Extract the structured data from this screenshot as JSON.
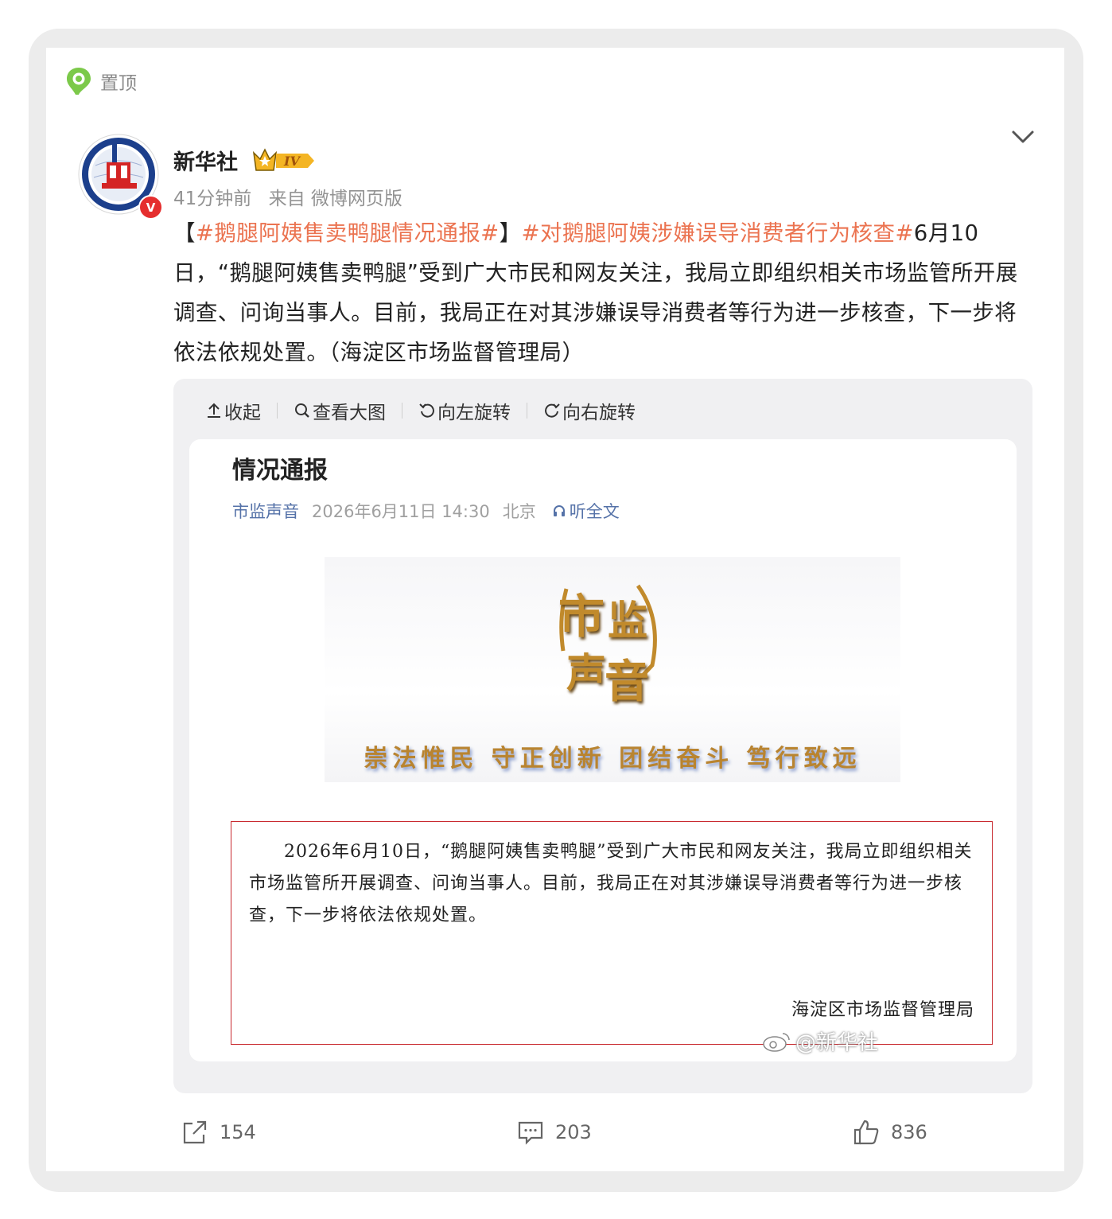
{
  "pinned": {
    "label": "置顶"
  },
  "user": {
    "name": "新华社",
    "badge_letter": "V",
    "level_text": "IV"
  },
  "meta": {
    "time": "41分钟前",
    "source": "来自 微博网页版"
  },
  "post": {
    "bracket_open": "【",
    "tag1": "#鹅腿阿姨售卖鸭腿情况通报#",
    "bracket_close": "】",
    "tag2": "#对鹅腿阿姨涉嫌误导消费者行为核查#",
    "body": "6月10日，“鹅腿阿姨售卖鸭腿”受到广大市民和网友关注，我局立即组织相关市场监管所开展调查、问询当事人。目前，我局正在对其涉嫌误导消费者等行为进一步核查，下一步将依法依规处置。（海淀区市场监督管理局）"
  },
  "toolbar": {
    "collapse": "收起",
    "view_large": "查看大图",
    "rotate_left": "向左旋转",
    "rotate_right": "向右旋转"
  },
  "document": {
    "title": "情况通报",
    "source": "市监声音",
    "datetime": "2026年6月11日 14:30",
    "location": "北京",
    "listen": "听全文",
    "logo_chars": [
      "市",
      "监",
      "声",
      "音"
    ],
    "slogan": "崇法惟民 守正创新 团结奋斗 笃行致远",
    "notice_body": "2026年6月10日，“鹅腿阿姨售卖鸭腿”受到广大市民和网友关注，我局立即组织相关市场监管所开展调查、问询当事人。目前，我局正在对其涉嫌误导消费者等行为进一步核查，下一步将依法依规处置。",
    "notice_sign": "海淀区市场监督管理局"
  },
  "watermark": "@新华社",
  "actions": {
    "reposts": "154",
    "comments": "203",
    "likes": "836"
  },
  "colors": {
    "tag": "#eb7350",
    "panel_bg": "#f0f0f2",
    "notice_border": "#c8282e",
    "link_blue": "#5572a8",
    "verified_red": "#e52e2e"
  },
  "icons": [
    "pin-icon",
    "avatar",
    "level-crown-icon",
    "chevron-down-icon",
    "collapse-icon",
    "zoom-icon",
    "rotate-left-icon",
    "rotate-right-icon",
    "headphone-icon",
    "share-icon",
    "comment-icon",
    "like-icon"
  ]
}
